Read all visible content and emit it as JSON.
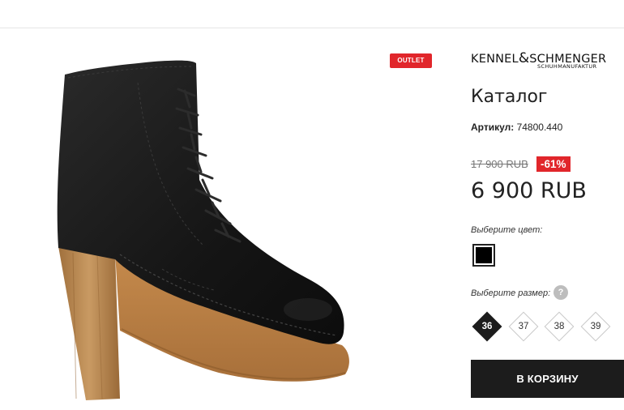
{
  "badges": {
    "outlet": "OUTLET",
    "discount": "-61%"
  },
  "brand": {
    "name": "KENNEL&SCHMENGER",
    "name_part1": "KENNEL",
    "ampersand": "&",
    "name_part2": "SCHMENGER",
    "subtitle": "SCHUHMANUFAKTUR"
  },
  "product": {
    "title": "Каталог",
    "sku_label": "Артикул:",
    "sku_value": "74800.440",
    "old_price": "17 900 RUB",
    "price": "6 900 RUB"
  },
  "color_picker": {
    "label": "Выберите цвет:",
    "selected_color": "#000000"
  },
  "size_picker": {
    "label": "Выберите размер:",
    "help": "?",
    "sizes": [
      "36",
      "37",
      "38",
      "39"
    ],
    "selected": "36"
  },
  "actions": {
    "add_to_cart": "В КОРЗИНУ"
  },
  "colors": {
    "accent_red": "#e1262b",
    "dark": "#1c1c1c"
  }
}
